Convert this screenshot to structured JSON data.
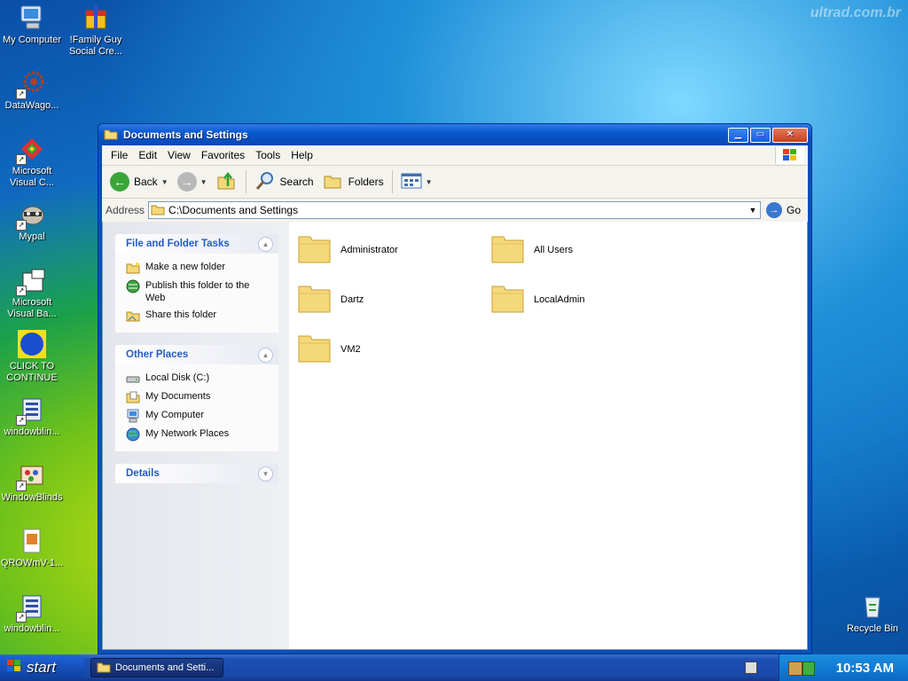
{
  "desktop": {
    "watermark": "ultrad.com.br",
    "icons": [
      {
        "label": "My Computer"
      },
      {
        "label": "!Family Guy Social Cre..."
      },
      {
        "label": "DataWago..."
      },
      {
        "label": "Microsoft Visual C..."
      },
      {
        "label": "Mypal"
      },
      {
        "label": "Microsoft Visual Ba..."
      },
      {
        "label": "CLICK TO CONTINUE"
      },
      {
        "label": "windowblin..."
      },
      {
        "label": "WindowBlinds"
      },
      {
        "label": "QROWmV-1..."
      },
      {
        "label": "windowblin..."
      },
      {
        "label": "Recycle Bin"
      }
    ]
  },
  "window": {
    "title": "Documents and Settings",
    "menu": [
      "File",
      "Edit",
      "View",
      "Favorites",
      "Tools",
      "Help"
    ],
    "toolbar": {
      "back": "Back",
      "search": "Search",
      "folders": "Folders"
    },
    "address": {
      "label": "Address",
      "value": "C:\\Documents and Settings",
      "go": "Go"
    },
    "taskpane": {
      "file_tasks": {
        "title": "File and Folder Tasks",
        "items": [
          "Make a new folder",
          "Publish this folder to the Web",
          "Share this folder"
        ]
      },
      "other_places": {
        "title": "Other Places",
        "items": [
          "Local Disk (C:)",
          "My Documents",
          "My Computer",
          "My Network Places"
        ]
      },
      "details": {
        "title": "Details"
      }
    },
    "folders": [
      "Administrator",
      "All Users",
      "Dartz",
      "LocalAdmin",
      "VM2"
    ]
  },
  "taskbar": {
    "start": "start",
    "task": "Documents and Setti...",
    "clock": "10:53 AM"
  },
  "colors": {
    "accent": "#215dc6",
    "folder": "#f4d97a"
  }
}
